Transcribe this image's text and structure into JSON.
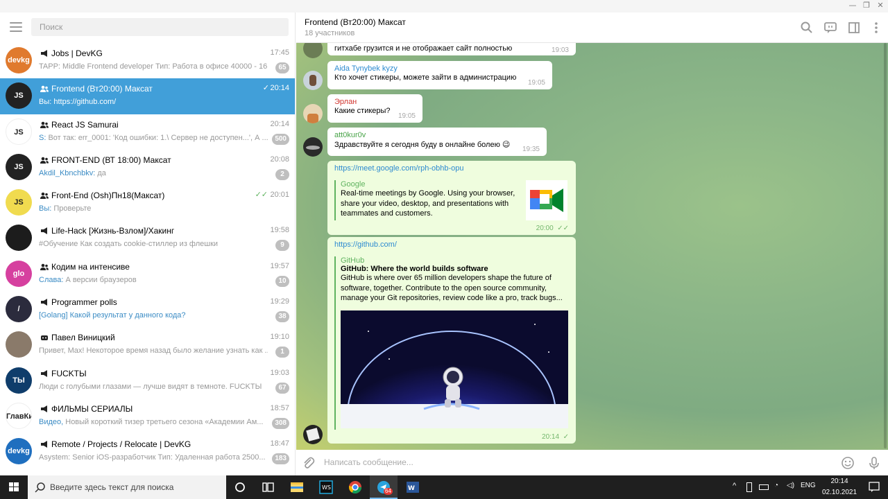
{
  "window": {
    "minimize": "—",
    "restore": "❐",
    "close": "✕"
  },
  "sidebar": {
    "search_placeholder": "Поиск",
    "chats": [
      {
        "name": "Jobs | DevKG",
        "time": "17:45",
        "preview_author": "",
        "preview": "TAPP: Middle Frontend developer Тип: Работа в офисе 40000 - 16...",
        "badge": "65",
        "type": "channel",
        "avatar_text": "devkg",
        "avatar_color": "#e07a2e",
        "check": ""
      },
      {
        "name": "Frontend (Вт20:00) Максат",
        "time": "20:14",
        "preview_author": "Вы: ",
        "preview": "https://github.com/",
        "badge": "",
        "type": "group",
        "avatar_text": "JS",
        "avatar_color": "#222222",
        "check": "✓",
        "active": true
      },
      {
        "name": "React JS Samurai",
        "time": "20:14",
        "preview_author": "S: ",
        "preview": "Вот так: err_0001: 'Код ошибки: 1.\\ Сервер не доступен...', А ...",
        "badge": "500",
        "type": "group",
        "avatar_text": "JS",
        "avatar_color": "#ffffff",
        "check": ""
      },
      {
        "name": "FRONT-END (ВТ 18:00) Максат",
        "time": "20:08",
        "preview_author": "Akdil_Kbnchbkv: ",
        "preview": "да",
        "badge": "2",
        "type": "group",
        "avatar_text": "JS",
        "avatar_color": "#222222",
        "check": ""
      },
      {
        "name": "Front-End (Osh)Пн18(Максат)",
        "time": "20:01",
        "preview_author": "Вы: ",
        "preview": "Проверьте",
        "badge": "",
        "type": "group",
        "avatar_text": "JS",
        "avatar_color": "#f0db4f",
        "check": "✓✓"
      },
      {
        "name": "Life-Hack [Жизнь-Взлом]/Хакинг",
        "time": "19:58",
        "preview_author": "",
        "preview": "#Обучение Как создать cookie-стиллер из флешки",
        "badge": "9",
        "type": "channel",
        "avatar_text": "",
        "avatar_color": "#1c1c1c",
        "check": ""
      },
      {
        "name": "Кодим на интенсиве",
        "time": "19:57",
        "preview_author": "Слава: ",
        "preview": "А версии браузеров",
        "badge": "10",
        "type": "group",
        "avatar_text": "glo",
        "avatar_color": "#d6409f",
        "check": ""
      },
      {
        "name": "Programmer polls",
        "time": "19:29",
        "preview_author": "",
        "preview": "[Golang] Какой результат у данного кода?",
        "badge": "38",
        "type": "channel",
        "avatar_text": "/",
        "avatar_color": "#2b2b3d",
        "check": "",
        "preview_link": true
      },
      {
        "name": "Павел Виницкий",
        "time": "19:10",
        "preview_author": "",
        "preview": "Привет, Max! Некоторое время назад было желание узнать как ...",
        "badge": "1",
        "type": "bot",
        "avatar_text": "",
        "avatar_color": "#8a7a6a",
        "check": ""
      },
      {
        "name": "FUCKТЫ",
        "time": "19:03",
        "preview_author": "",
        "preview": "Люди с голубыми глазами — лучше видят в темноте.    FUCKТЫ",
        "badge": "67",
        "type": "channel",
        "avatar_text": "ТЫ",
        "avatar_color": "#0f3d6b",
        "check": ""
      },
      {
        "name": "ФИЛЬМЫ СЕРИАЛЫ",
        "time": "18:57",
        "preview_author": "Видео, ",
        "preview": "Новый короткий тизер третьего сезона «Академии Ам...",
        "badge": "308",
        "type": "channel",
        "avatar_text": "ГлавКино",
        "avatar_color": "#ffffff",
        "check": ""
      },
      {
        "name": "Remote / Projects / Relocate | DevKG",
        "time": "18:47",
        "preview_author": "",
        "preview": "Asystem: Senior iOS-разработчик Тип: Удаленная работа 2500...",
        "badge": "183",
        "type": "channel",
        "avatar_text": "devkg",
        "avatar_color": "#1f6fbf",
        "check": ""
      }
    ]
  },
  "header": {
    "title": "Frontend (Вт20:00) Максат",
    "subtitle": "18 участников"
  },
  "messages": {
    "m0_text": "гитхабе грузится и не отображает сайт полностью",
    "m0_time": "19:03",
    "m1_author": "Aida Tynybek kyzy",
    "m1_text": "Кто хочет стикеры, можете зайти в администрацию",
    "m1_time": "19:05",
    "m2_author": "Эрлан",
    "m2_text": "Какие стикеры?",
    "m2_time": "19:05",
    "m3_author": "att0kur0v",
    "m3_text": "Здравствуйте я сегодня буду в онлайне болею 😉",
    "m3_time": "19:35",
    "m4_link": "https://meet.google.com/rph-obhb-opu",
    "m4_site": "Google",
    "m4_desc1": "Real-time meetings by Google. Using your browser,",
    "m4_desc2": "share your video, desktop, and presentations with",
    "m4_desc3": "teammates and customers.",
    "m4_time": "20:00",
    "m4_check": "✓✓",
    "m5_link": "https://github.com/",
    "m5_site": "GitHub",
    "m5_title": "GitHub: Where the world builds software",
    "m5_desc1": "GitHub is where over 65 million developers shape the future of",
    "m5_desc2": "software, together. Contribute to the open source community,",
    "m5_desc3": "manage your Git repositories, review code like a pro, track bugs...",
    "m5_time": "20:14",
    "m5_check": "✓"
  },
  "composer": {
    "placeholder": "Написать сообщение..."
  },
  "taskbar": {
    "search_placeholder": "Введите здесь текст для поиска",
    "lang": "ENG",
    "time": "20:14",
    "date": "02.10.2021",
    "telegram_badge": "64"
  },
  "colors": {
    "accent": "#419fd9",
    "green": "#5fb35f",
    "link": "#2d8ad0"
  }
}
